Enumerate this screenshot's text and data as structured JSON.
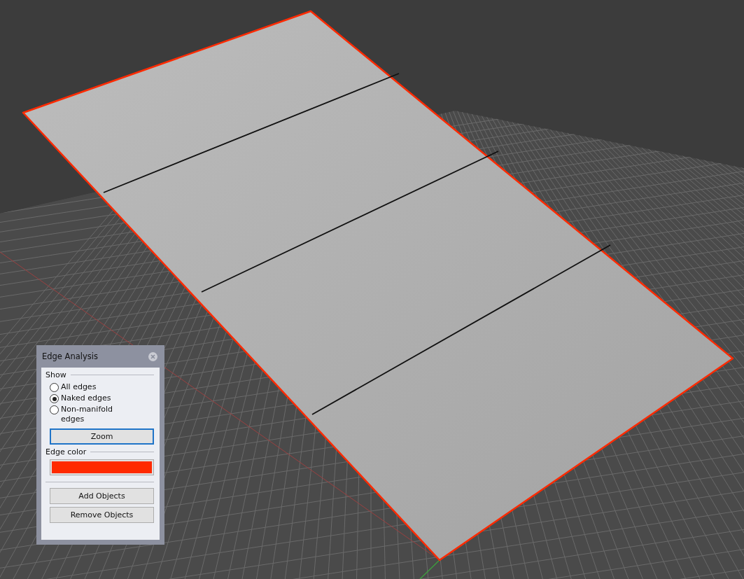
{
  "panel": {
    "title": "Edge Analysis",
    "show_label": "Show",
    "options": [
      {
        "label": "All edges",
        "selected": false
      },
      {
        "label": "Naked edges",
        "selected": true
      },
      {
        "label": "Non-manifold edges",
        "selected": false
      }
    ],
    "zoom_button": "Zoom",
    "edge_color_label": "Edge color",
    "edge_color": {
      "color": "#ff2a00"
    },
    "buttons": [
      "Add Objects",
      "Remove Objects"
    ]
  }
}
